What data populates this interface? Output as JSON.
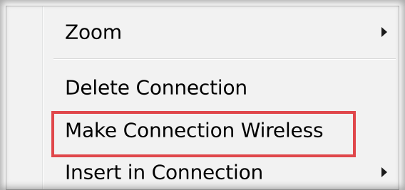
{
  "context_menu": {
    "items": [
      {
        "label": "Zoom",
        "has_submenu": true,
        "icon": "chevron-right-icon"
      },
      {
        "label": "Delete Connection",
        "has_submenu": false
      },
      {
        "label": "Make Connection Wireless",
        "has_submenu": false,
        "highlighted": true
      },
      {
        "label": "Insert in Connection",
        "has_submenu": true,
        "icon": "chevron-right-icon"
      }
    ]
  },
  "colors": {
    "menu_background": "#f2f2f2",
    "highlight_border": "#e0474b",
    "text": "#000000"
  }
}
